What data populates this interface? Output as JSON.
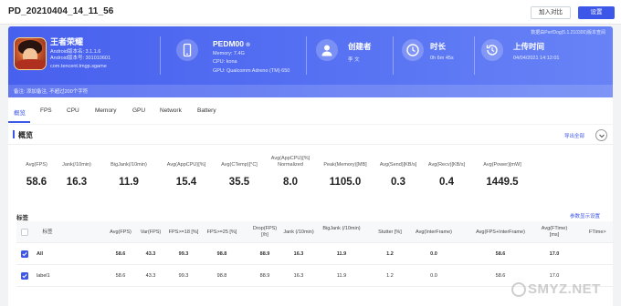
{
  "header": {
    "title": "PD_20210404_14_11_56",
    "compare_label": "加入对比",
    "settings_label": "设置"
  },
  "banner": {
    "pd_version": "数据由PerfDog(5.1.210300)版本查阅",
    "app": {
      "name": "王者荣耀",
      "version_line1": "Android版本名: 3.1.1.6",
      "version_line2": "Android版本号: 301010601",
      "package": "com.tencent.tmgp.sgame"
    },
    "device": {
      "name": "PEDM00",
      "memory": "Memory: 7.4G",
      "cpu": "CPU: kona",
      "gpu": "GPU: Qualcomm Adreno (TM) 650"
    },
    "creator": {
      "title": "创建者",
      "value": "李 文"
    },
    "duration": {
      "title": "时长",
      "value": "0h 6m 45s"
    },
    "upload": {
      "title": "上传时间",
      "value": "04/04/2021 14:12:01"
    },
    "note": "备注: 添加备注, 不超过200个字符"
  },
  "tabs": [
    {
      "label": "概览",
      "active": true
    },
    {
      "label": "FPS"
    },
    {
      "label": "CPU"
    },
    {
      "label": "Memory"
    },
    {
      "label": "GPU"
    },
    {
      "label": "Network"
    },
    {
      "label": "Battery"
    }
  ],
  "overview": {
    "title": "概览",
    "export_label": "导出全部",
    "metrics": [
      {
        "label": "Avg(FPS)",
        "value": "58.6"
      },
      {
        "label": "Jank(/10min)",
        "value": "16.3"
      },
      {
        "label": "BigJank(/10min)",
        "value": "11.9"
      },
      {
        "label": "Avg(AppCPU)[%]",
        "value": "15.4"
      },
      {
        "label": "Avg(CTemp)[°C]",
        "value": "35.5"
      },
      {
        "label": "Avg(AppCPU)[%] Normalized",
        "value": "8.0"
      },
      {
        "label": "Peak(Memory)[MB]",
        "value": "1105.0"
      },
      {
        "label": "Avg(Send)[KB/s]",
        "value": "0.3"
      },
      {
        "label": "Avg(Recv)[KB/s]",
        "value": "0.4"
      },
      {
        "label": "Avg(Power)[mW]",
        "value": "1449.5"
      }
    ],
    "tag_label": "标签",
    "param_link": "参数显示设置",
    "table": {
      "headers": [
        "标签",
        "Avg(FPS)",
        "Var(FPS)",
        "FPS>=18 [%]",
        "FPS>=25 [%]",
        "Drop(FPS) [/h]",
        "Jank (/10min)",
        "BigJank (/10min)",
        "Stutter [%]",
        "Avg(InterFrame)",
        "Avg(FPS+InterFrame)",
        "Avg(FTime) [ms]",
        "FTime>"
      ],
      "rows": [
        {
          "label": "All",
          "values": [
            "58.6",
            "43.3",
            "99.3",
            "98.8",
            "88.9",
            "16.3",
            "11.9",
            "1.2",
            "0.0",
            "58.6",
            "17.0",
            ""
          ]
        },
        {
          "label": "label1",
          "values": [
            "58.6",
            "43.3",
            "99.3",
            "98.8",
            "88.9",
            "16.3",
            "11.9",
            "1.2",
            "0.0",
            "58.6",
            "17.0",
            ""
          ]
        }
      ]
    }
  },
  "watermark": "SMYZ.NET",
  "colors": {
    "accent": "#3d57e8",
    "banner_start": "#4860ee",
    "banner_end": "#6883f6"
  }
}
